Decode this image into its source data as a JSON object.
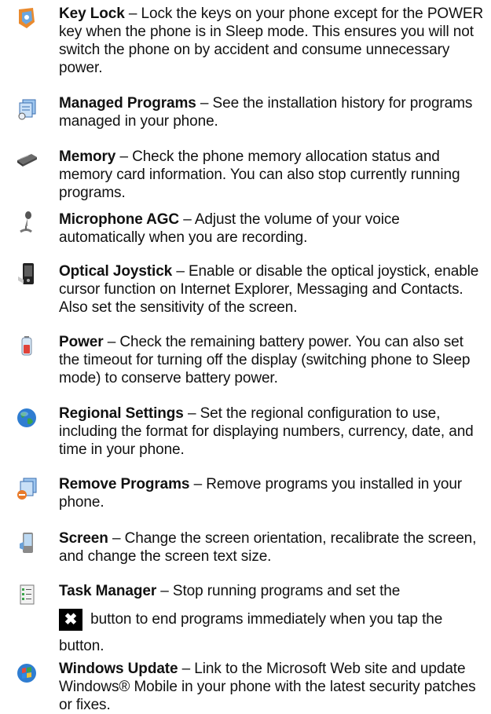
{
  "items": [
    {
      "term": "Key Lock",
      "desc": " – Lock the keys on your phone except for the POWER key when the phone is in Sleep mode. This ensures you will not switch the phone on by accident and consume unnecessary power.",
      "icon": "key-lock-icon"
    },
    {
      "term": "Managed Programs",
      "desc": " – See the installation history for programs managed in your phone.",
      "icon": "managed-programs-icon"
    },
    {
      "term": "Memory",
      "desc": " – Check the phone memory allocation status and memory card information. You can also stop currently running programs.",
      "icon": "memory-chip-icon"
    },
    {
      "term": "Microphone AGC",
      "desc": " – Adjust the volume of your voice automatically when you are recording.",
      "icon": "microphone-icon"
    },
    {
      "term": "Optical Joystick",
      "desc": " – Enable or disable the optical joystick, enable cursor function on Internet Explorer, Messaging and Contacts. Also set the sensitivity of the screen.",
      "icon": "optical-joystick-icon"
    },
    {
      "term": "Power",
      "desc": " – Check the remaining battery power. You can also set the timeout for turning off the display (switching phone to Sleep mode) to conserve battery power.",
      "icon": "battery-icon"
    },
    {
      "term": "Regional Settings",
      "desc": " – Set the regional configuration to use, including the format for displaying numbers, currency, date, and time in your phone.",
      "icon": "globe-icon"
    },
    {
      "term": "Remove Programs",
      "desc": " – Remove programs you installed in your phone.",
      "icon": "remove-programs-icon"
    },
    {
      "term": "Screen",
      "desc": " – Change the screen orientation, recalibrate the screen, and change the screen text size.",
      "icon": "screen-icon"
    },
    {
      "term": "Task Manager",
      "desc_before": " – Stop running programs and set the",
      "button_glyph": "✖",
      "desc_after": " button to end programs immediately when you tap the button.",
      "icon": "task-manager-icon"
    },
    {
      "term": "Windows Update",
      "desc": " – Link to the Microsoft Web site and update Windows® Mobile in your phone with the latest security patches or fixes.",
      "icon": "windows-update-icon"
    }
  ]
}
